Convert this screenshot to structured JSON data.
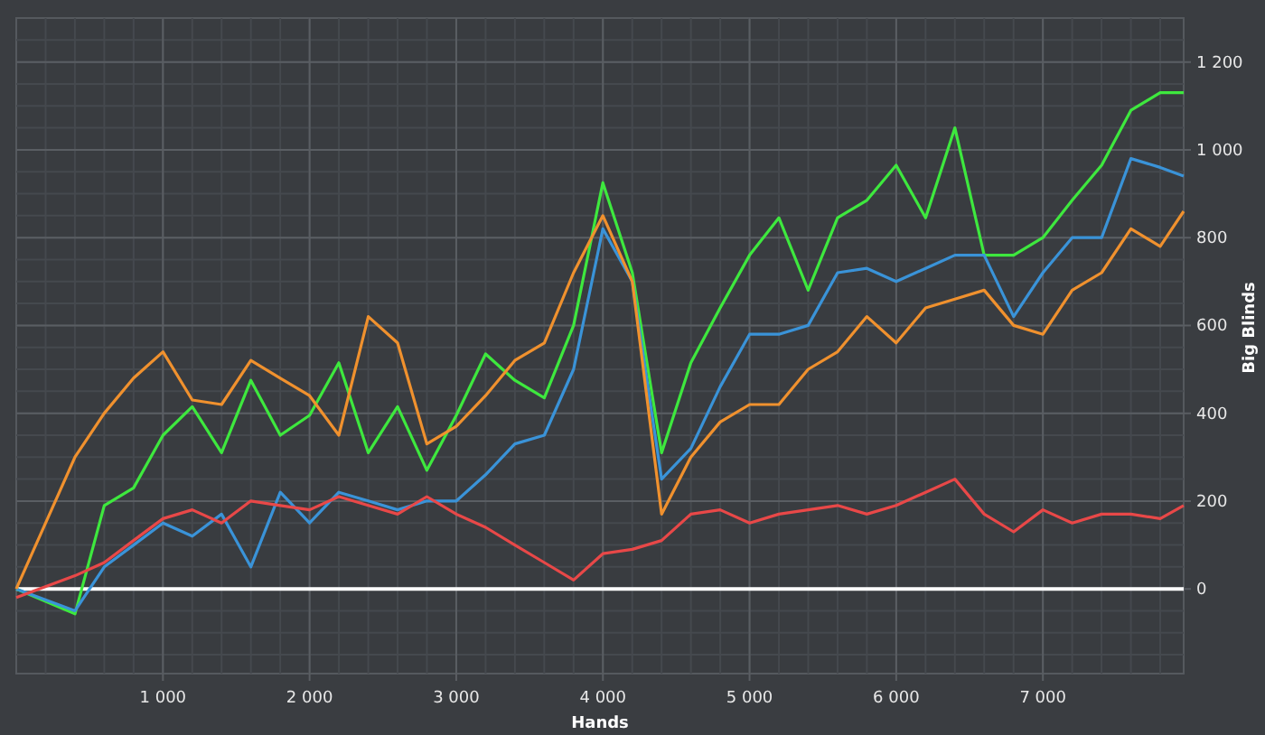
{
  "chart_data": {
    "type": "line",
    "grid": true,
    "xlabel": "Hands",
    "ylabel": "Big Blinds",
    "x": [
      0,
      400,
      600,
      800,
      1000,
      1200,
      1400,
      1600,
      1800,
      2000,
      2200,
      2400,
      2600,
      2800,
      3000,
      3200,
      3400,
      3600,
      3800,
      4000,
      4200,
      4400,
      4600,
      4800,
      5000,
      5200,
      5400,
      5600,
      5800,
      6000,
      6200,
      6400,
      6600,
      6800,
      7000,
      7200,
      7400,
      7600,
      7800,
      7960
    ],
    "series": [
      {
        "color": "#3ee83e",
        "values": [
          0,
          -57,
          190,
          230,
          350,
          415,
          310,
          475,
          350,
          395,
          515,
          310,
          415,
          270,
          395,
          535,
          475,
          435,
          600,
          925,
          720,
          310,
          515,
          640,
          760,
          845,
          680,
          845,
          885,
          965,
          845,
          1050,
          760,
          760,
          800,
          885,
          965,
          1090,
          1130,
          1130
        ]
      },
      {
        "color": "#3a93d8",
        "values": [
          0,
          -50,
          50,
          100,
          150,
          120,
          170,
          50,
          220,
          150,
          220,
          200,
          180,
          200,
          200,
          260,
          330,
          350,
          500,
          820,
          700,
          250,
          320,
          460,
          580,
          580,
          600,
          720,
          730,
          700,
          730,
          760,
          760,
          620,
          720,
          800,
          800,
          980,
          960,
          940
        ]
      },
      {
        "color": "#f0912e",
        "values": [
          0,
          300,
          400,
          480,
          540,
          430,
          420,
          520,
          480,
          440,
          350,
          620,
          560,
          330,
          370,
          440,
          520,
          560,
          720,
          850,
          700,
          170,
          300,
          380,
          420,
          420,
          500,
          540,
          620,
          560,
          640,
          660,
          680,
          600,
          580,
          680,
          720,
          820,
          780,
          860
        ]
      },
      {
        "color": "#e84848",
        "values": [
          -20,
          30,
          60,
          110,
          160,
          180,
          150,
          200,
          190,
          180,
          210,
          190,
          170,
          210,
          170,
          140,
          100,
          60,
          20,
          80,
          90,
          110,
          170,
          180,
          150,
          170,
          180,
          190,
          170,
          190,
          220,
          250,
          170,
          130,
          180,
          150,
          170,
          170,
          160,
          190
        ]
      }
    ],
    "xlim": [
      0,
      7960
    ],
    "ylim": [
      -193,
      1300
    ],
    "xticks": [
      {
        "value": 1000,
        "label": "1 000"
      },
      {
        "value": 2000,
        "label": "2 000"
      },
      {
        "value": 3000,
        "label": "3 000"
      },
      {
        "value": 4000,
        "label": "4 000"
      },
      {
        "value": 5000,
        "label": "5 000"
      },
      {
        "value": 6000,
        "label": "6 000"
      },
      {
        "value": 7000,
        "label": "7 000"
      }
    ],
    "yticks": [
      {
        "value": 0,
        "label": "0"
      },
      {
        "value": 200,
        "label": "200"
      },
      {
        "value": 400,
        "label": "400"
      },
      {
        "value": 600,
        "label": "600"
      },
      {
        "value": 800,
        "label": "800"
      },
      {
        "value": 1000,
        "label": "1 000"
      },
      {
        "value": 1200,
        "label": "1 200"
      }
    ]
  }
}
